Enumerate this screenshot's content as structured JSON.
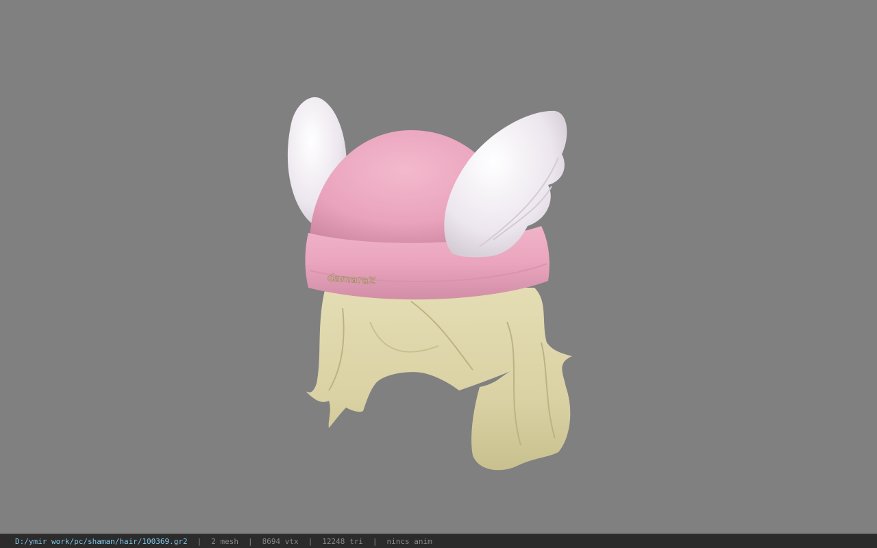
{
  "viewport": {
    "model_label": "damaraZ",
    "colors": {
      "background": "#808080",
      "hat": "#eba7bf",
      "wings": "#ece8ee",
      "hair": "#dcd5a8"
    }
  },
  "status_bar": {
    "file_path": "D:/ymir work/pc/shaman/hair/100369.gr2",
    "separator": "|",
    "mesh_count": "2 mesh",
    "vertex_count": "8694 vtx",
    "triangle_count": "12248 tri",
    "animation_state": "nincs anim"
  }
}
